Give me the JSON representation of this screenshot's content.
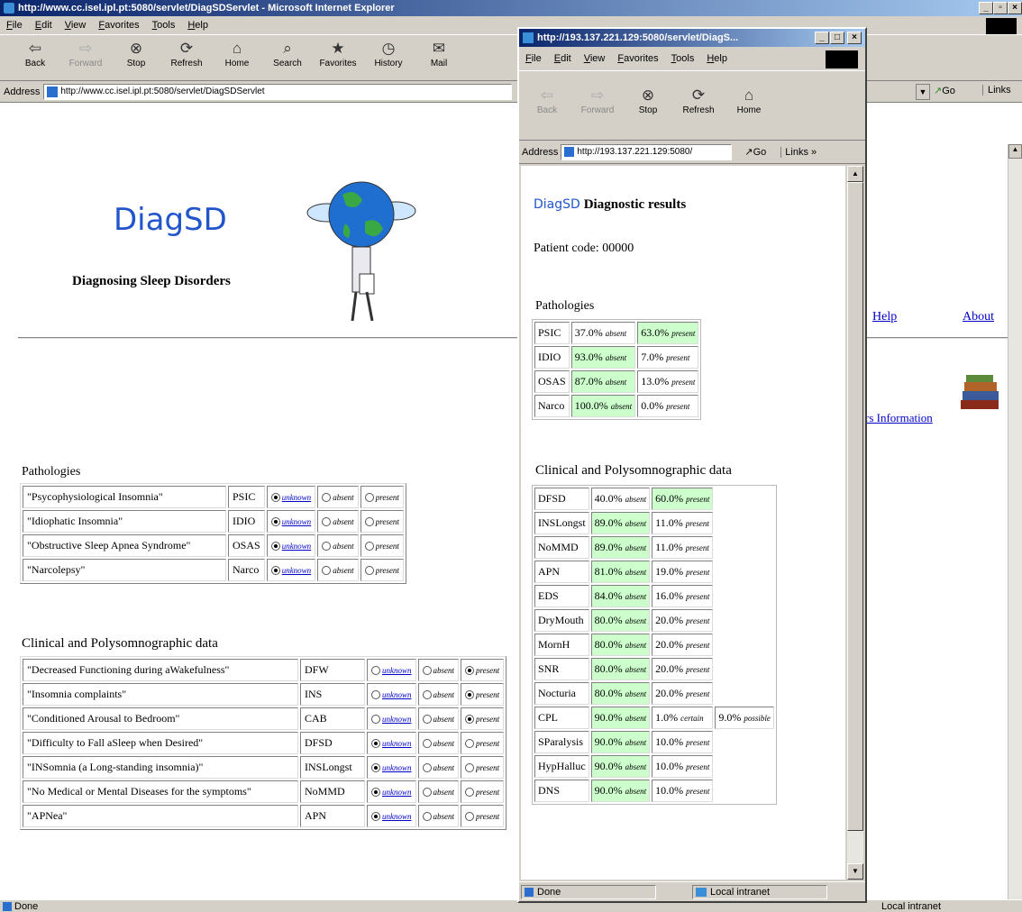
{
  "main_window": {
    "title": "http://www.cc.isel.ipl.pt:5080/servlet/DiagSDServlet - Microsoft Internet Explorer",
    "menu": [
      "File",
      "Edit",
      "View",
      "Favorites",
      "Tools",
      "Help"
    ],
    "toolbar": [
      {
        "label": "Back",
        "icon": "back-arrow-icon"
      },
      {
        "label": "Forward",
        "icon": "forward-arrow-icon"
      },
      {
        "label": "Stop",
        "icon": "stop-icon"
      },
      {
        "label": "Refresh",
        "icon": "refresh-icon"
      },
      {
        "label": "Home",
        "icon": "home-icon"
      },
      {
        "label": "Search",
        "icon": "search-icon"
      },
      {
        "label": "Favorites",
        "icon": "favorites-icon"
      },
      {
        "label": "History",
        "icon": "history-icon"
      },
      {
        "label": "Mail",
        "icon": "mail-icon"
      }
    ],
    "address_label": "Address",
    "address_value": "http://www.cc.isel.ipl.pt:5080/servlet/DiagSDServlet",
    "go_label": "Go",
    "links_label": "Links",
    "status": "Done",
    "zone": "Local intranet"
  },
  "page": {
    "logo": "DiagSD",
    "subtitle": "Diagnosing Sleep Disorders",
    "nav_help": "Help",
    "nav_about": "About",
    "users_info": "rs Information",
    "pathologies_heading": "Pathologies",
    "pathologies": [
      {
        "name": "\"Psycophysiological Insomnia\"",
        "code": "PSIC",
        "state": "unknown"
      },
      {
        "name": "\"Idiophatic Insomnia\"",
        "code": "IDIO",
        "state": "unknown"
      },
      {
        "name": "\"Obstructive Sleep Apnea Syndrome\"",
        "code": "OSAS",
        "state": "unknown"
      },
      {
        "name": "\"Narcolepsy\"",
        "code": "Narco",
        "state": "unknown"
      }
    ],
    "options": {
      "unknown": "unknown",
      "absent": "absent",
      "present": "present"
    },
    "clinical_heading": "Clinical and Polysomnographic data",
    "clinical": [
      {
        "name": "\"Decreased Functioning during aWakefulness\"",
        "code": "DFW",
        "state": "present"
      },
      {
        "name": "\"Insomnia complaints\"",
        "code": "INS",
        "state": "present"
      },
      {
        "name": "\"Conditioned Arousal to Bedroom\"",
        "code": "CAB",
        "state": "present"
      },
      {
        "name": "\"Difficulty to Fall aSleep when Desired\"",
        "code": "DFSD",
        "state": "unknown"
      },
      {
        "name": "\"INSomnia (a Long-standing insomnia)\"",
        "code": "INSLongst",
        "state": "unknown"
      },
      {
        "name": "\"No Medical or Mental Diseases for the symptoms\"",
        "code": "NoMMD",
        "state": "unknown"
      },
      {
        "name": "\"APNea\"",
        "code": "APN",
        "state": "unknown"
      }
    ]
  },
  "popup": {
    "title": "http://193.137.221.129:5080/servlet/DiagS...",
    "menu": [
      "File",
      "Edit",
      "View",
      "Favorites",
      "Tools",
      "Help"
    ],
    "toolbar": [
      {
        "label": "Back",
        "icon": "back-arrow-icon"
      },
      {
        "label": "Forward",
        "icon": "forward-arrow-icon"
      },
      {
        "label": "Stop",
        "icon": "stop-icon"
      },
      {
        "label": "Refresh",
        "icon": "refresh-icon"
      },
      {
        "label": "Home",
        "icon": "home-icon"
      }
    ],
    "address_label": "Address",
    "address_value": "http://193.137.221.129:5080/",
    "go_label": "Go",
    "links_label": "Links",
    "heading_logo": "DiagSD",
    "heading_text": "Diagnostic results",
    "patient_code": "Patient code: 00000",
    "pathologies_heading": "Pathologies",
    "pathologies": [
      {
        "code": "PSIC",
        "absent": "37.0%",
        "present": "63.0%",
        "hl": "present"
      },
      {
        "code": "IDIO",
        "absent": "93.0%",
        "present": "7.0%",
        "hl": "absent"
      },
      {
        "code": "OSAS",
        "absent": "87.0%",
        "present": "13.0%",
        "hl": "absent"
      },
      {
        "code": "Narco",
        "absent": "100.0%",
        "present": "0.0%",
        "hl": "absent"
      }
    ],
    "clinical_heading": "Clinical and Polysomnographic data",
    "clinical": [
      {
        "code": "DFSD",
        "absent": "40.0%",
        "present": "60.0%",
        "hl": "present"
      },
      {
        "code": "INSLongst",
        "absent": "89.0%",
        "present": "11.0%",
        "hl": "absent"
      },
      {
        "code": "NoMMD",
        "absent": "89.0%",
        "present": "11.0%",
        "hl": "absent"
      },
      {
        "code": "APN",
        "absent": "81.0%",
        "present": "19.0%",
        "hl": "absent"
      },
      {
        "code": "EDS",
        "absent": "84.0%",
        "present": "16.0%",
        "hl": "absent"
      },
      {
        "code": "DryMouth",
        "absent": "80.0%",
        "present": "20.0%",
        "hl": "absent"
      },
      {
        "code": "MornH",
        "absent": "80.0%",
        "present": "20.0%",
        "hl": "absent"
      },
      {
        "code": "SNR",
        "absent": "80.0%",
        "present": "20.0%",
        "hl": "absent"
      },
      {
        "code": "Nocturia",
        "absent": "80.0%",
        "present": "20.0%",
        "hl": "absent"
      },
      {
        "code": "CPL",
        "absent": "90.0%",
        "mid": "1.0%",
        "mid_label": "certain",
        "present": "9.0%",
        "present_label": "possible",
        "hl": "absent"
      },
      {
        "code": "SParalysis",
        "absent": "90.0%",
        "present": "10.0%",
        "hl": "absent"
      },
      {
        "code": "HypHalluc",
        "absent": "90.0%",
        "present": "10.0%",
        "hl": "absent"
      },
      {
        "code": "DNS",
        "absent": "90.0%",
        "present": "10.0%",
        "hl": "absent"
      }
    ],
    "absent_label": "absent",
    "present_label": "present",
    "status": "Done",
    "zone": "Local intranet"
  },
  "colors": {
    "titlebar": "#0a246a",
    "chrome": "#d4d0c8",
    "highlight": "#ccffcc",
    "link": "#0000cc",
    "logo": "#2255cc"
  }
}
